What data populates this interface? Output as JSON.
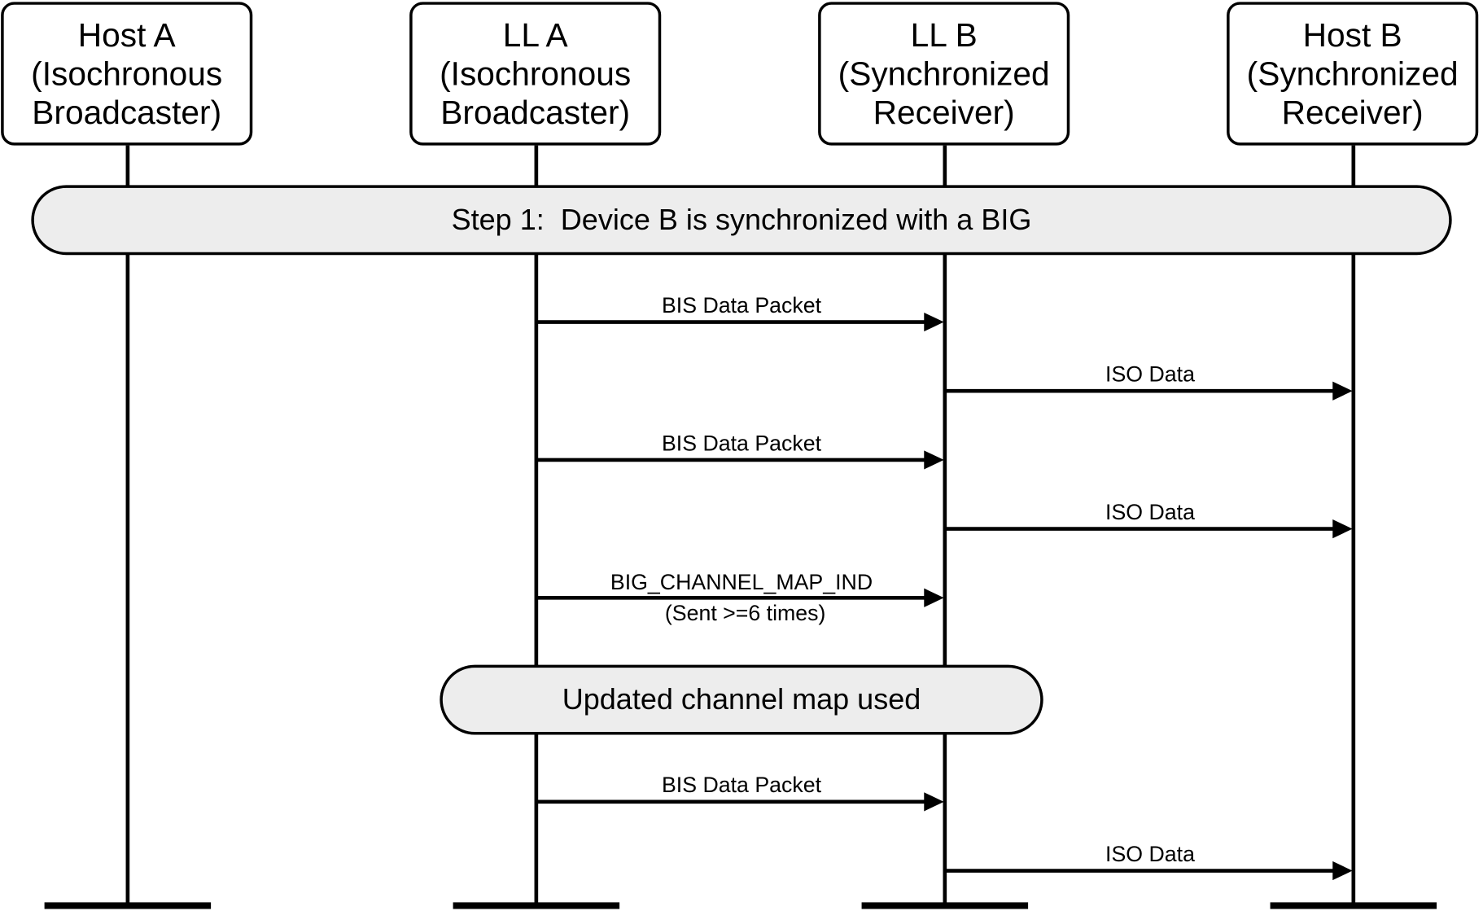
{
  "diagram": {
    "type": "sequence-diagram",
    "participants": [
      {
        "id": "hostA",
        "name": "Host A",
        "role": "(Isochronous",
        "role2": "Broadcaster)"
      },
      {
        "id": "llA",
        "name": "LL A",
        "role": "(Isochronous",
        "role2": "Broadcaster)"
      },
      {
        "id": "llB",
        "name": "LL B",
        "role": "(Synchronized",
        "role2": "Receiver)"
      },
      {
        "id": "hostB",
        "name": "Host B",
        "role": "(Synchronized",
        "role2": "Receiver)"
      }
    ],
    "notes": [
      {
        "id": "step1",
        "text": "Step 1:  Device B is synchronized with a BIG",
        "spans": [
          "hostA",
          "hostB"
        ]
      },
      {
        "id": "updated",
        "text": "Updated channel map used",
        "spans": [
          "llA",
          "llB"
        ]
      }
    ],
    "messages": [
      {
        "from": "llA",
        "to": "llB",
        "label": "BIS Data Packet",
        "sublabel": ""
      },
      {
        "from": "llB",
        "to": "hostB",
        "label": "ISO Data",
        "sublabel": ""
      },
      {
        "from": "llA",
        "to": "llB",
        "label": "BIS Data Packet",
        "sublabel": ""
      },
      {
        "from": "llB",
        "to": "hostB",
        "label": "ISO Data",
        "sublabel": ""
      },
      {
        "from": "llA",
        "to": "llB",
        "label": "BIG_CHANNEL_MAP_IND",
        "sublabel": "(Sent >=6 times)"
      },
      {
        "from": "llA",
        "to": "llB",
        "label": "BIS Data Packet",
        "sublabel": ""
      },
      {
        "from": "llB",
        "to": "hostB",
        "label": "ISO Data",
        "sublabel": ""
      }
    ],
    "colors": {
      "line": "#000000",
      "note_fill": "#ededed",
      "box_fill": "#ffffff"
    }
  }
}
